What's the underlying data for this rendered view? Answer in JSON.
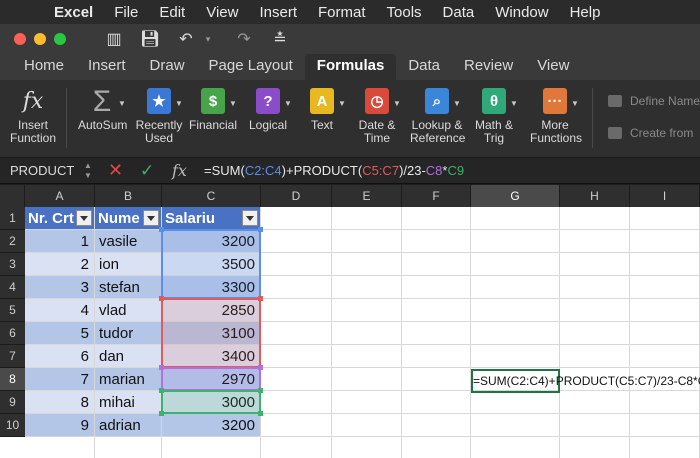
{
  "menubar": {
    "app": "Excel",
    "items": [
      "File",
      "Edit",
      "View",
      "Insert",
      "Format",
      "Tools",
      "Data",
      "Window",
      "Help"
    ]
  },
  "titlebar": {
    "lights": [
      "#ff5f57",
      "#febc2e",
      "#28c840"
    ]
  },
  "ribbon_tabs": [
    "Home",
    "Insert",
    "Draw",
    "Page Layout",
    "Formulas",
    "Data",
    "Review",
    "View"
  ],
  "active_tab": "Formulas",
  "ribbon": {
    "insert_function": [
      "Insert",
      "Function"
    ],
    "buttons": [
      {
        "id": "autosum",
        "lines": [
          "AutoSum"
        ],
        "glyph": "Σ",
        "color": "#9a9a9a"
      },
      {
        "id": "recently-used",
        "lines": [
          "Recently",
          "Used"
        ],
        "glyph": "★",
        "color": "#3b78d6"
      },
      {
        "id": "financial",
        "lines": [
          "Financial"
        ],
        "glyph": "$",
        "color": "#48a44a"
      },
      {
        "id": "logical",
        "lines": [
          "Logical"
        ],
        "glyph": "?",
        "color": "#8a4cc8"
      },
      {
        "id": "text",
        "lines": [
          "Text"
        ],
        "glyph": "A",
        "color": "#e8b820"
      },
      {
        "id": "date-time",
        "lines": [
          "Date &",
          "Time"
        ],
        "glyph": "◷",
        "color": "#d84a3a"
      },
      {
        "id": "lookup-reference",
        "lines": [
          "Lookup &",
          "Reference"
        ],
        "glyph": "⌕",
        "color": "#3a86d8"
      },
      {
        "id": "math-trig",
        "lines": [
          "Math &",
          "Trig"
        ],
        "glyph": "θ",
        "color": "#2fa87a"
      },
      {
        "id": "more-functions",
        "lines": [
          "More",
          "Functions"
        ],
        "glyph": "···",
        "color": "#e0783a"
      }
    ],
    "define_name": "Define Name",
    "create_from": "Create from"
  },
  "formula_bar": {
    "name_box": "PRODUCT",
    "formula_tokens": [
      {
        "t": "=SUM(",
        "c": "plain"
      },
      {
        "t": "C2:C4",
        "c": "blue"
      },
      {
        "t": ")+PRODUCT(",
        "c": "plain"
      },
      {
        "t": "C5:C7",
        "c": "red"
      },
      {
        "t": ")/23-",
        "c": "plain"
      },
      {
        "t": "C8",
        "c": "purple"
      },
      {
        "t": "*",
        "c": "plain"
      },
      {
        "t": "C9",
        "c": "green"
      }
    ]
  },
  "grid": {
    "columns": [
      "A",
      "B",
      "C",
      "D",
      "E",
      "F",
      "G",
      "H",
      "I"
    ],
    "selected_column": "G",
    "rows": [
      "1",
      "2",
      "3",
      "4",
      "5",
      "6",
      "7",
      "8",
      "9",
      "10"
    ],
    "selected_row": "8",
    "headers": [
      "Nr. Crt",
      "Nume",
      "Salariu"
    ],
    "data": [
      {
        "nr": "1",
        "nume": "vasile",
        "salariu": "3200"
      },
      {
        "nr": "2",
        "nume": "ion",
        "salariu": "3500"
      },
      {
        "nr": "3",
        "nume": "stefan",
        "salariu": "3300"
      },
      {
        "nr": "4",
        "nume": "vlad",
        "salariu": "2850"
      },
      {
        "nr": "5",
        "nume": "tudor",
        "salariu": "3100"
      },
      {
        "nr": "6",
        "nume": "dan",
        "salariu": "3400"
      },
      {
        "nr": "7",
        "nume": "marian",
        "salariu": "2970"
      },
      {
        "nr": "8",
        "nume": "mihai",
        "salariu": "3000"
      },
      {
        "nr": "9",
        "nume": "adrian",
        "salariu": "3200"
      }
    ],
    "active_cell_text": "=SUM(C2:C4)+PRODUCT(C5:C7)/23-C8*C9"
  },
  "colors": {
    "band_dark": "#b4c6e7",
    "band_light": "#d9e1f2",
    "header_blue": "#4a72c4",
    "ref_blue": "#5a8ee8",
    "ref_red": "#e35a5a",
    "ref_purple": "#b070e0",
    "ref_green": "#3cb26a"
  }
}
